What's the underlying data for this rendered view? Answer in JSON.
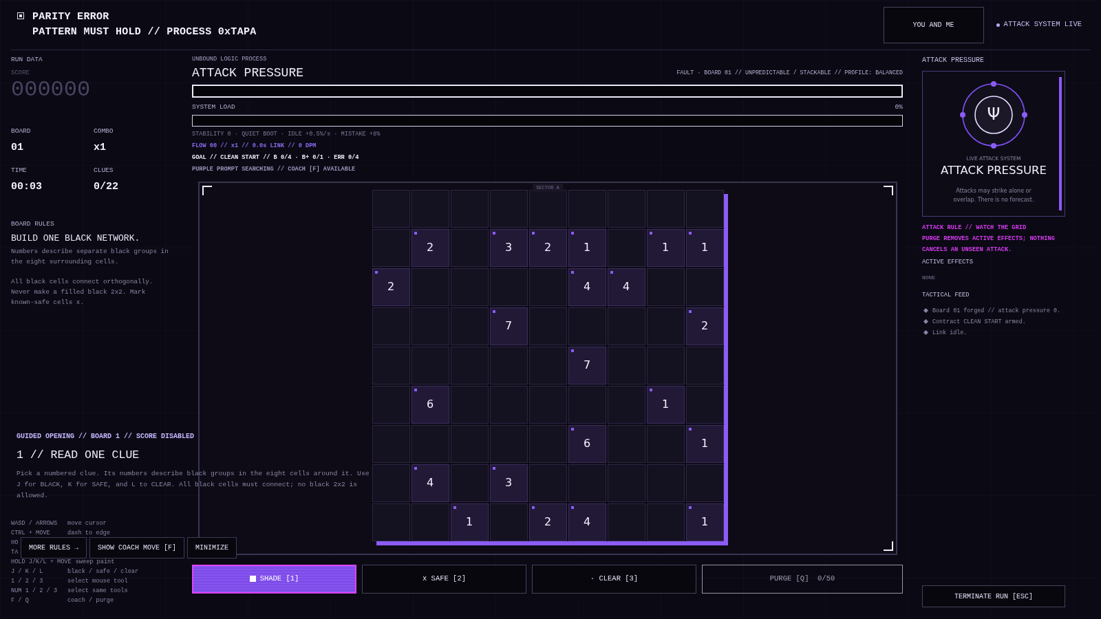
{
  "header": {
    "lines": [
      "PARITY ERROR",
      "PATTERN MUST HOLD // PROCESS 0xTAPA"
    ],
    "partner_button": "YOU AND ME",
    "status": "ATTACK SYSTEM LIVE"
  },
  "run_data": {
    "title": "RUN DATA",
    "score_label": "SCORE",
    "score": "000000",
    "stats": [
      {
        "label": "BOARD",
        "value": "01"
      },
      {
        "label": "COMBO",
        "value": "x1"
      },
      {
        "label": "TIME",
        "value": "00:03"
      },
      {
        "label": "CLUES",
        "value": "0/22"
      }
    ]
  },
  "board_rules": {
    "title": "BOARD RULES",
    "heading": "BUILD ONE BLACK NETWORK.",
    "paragraphs": [
      "Numbers describe separate black groups in the eight surrounding cells.",
      "All black cells connect orthogonally. Never make a filled black 2x2. Mark known-safe cells x."
    ]
  },
  "shortcuts": [
    {
      "keys": "WASD / ARROWS",
      "action": "move cursor"
    },
    {
      "keys": "CTRL + MOVE",
      "action": "dash to edge"
    },
    {
      "keys": "HO"
    },
    {
      "keys": "TA"
    },
    {
      "keys": "HOLD J/K/L + MOVE",
      "action": "sweep paint"
    },
    {
      "keys": "J / K / L",
      "action": "black / safe / clear"
    },
    {
      "keys": "1 / 2 / 3",
      "action": "select mouse tool"
    },
    {
      "keys": "NUM 1 / 2 / 3",
      "action": "select same tools"
    },
    {
      "keys": "F / Q",
      "action": "coach / purge"
    }
  ],
  "guide": {
    "kicker": "GUIDED OPENING // BOARD 1 // SCORE DISABLED",
    "heading": "1 // READ ONE CLUE",
    "text": "Pick a numbered clue. Its numbers describe black groups in the eight cells around it. Use J for BLACK, K for SAFE, and L to CLEAR. All black cells must connect; no black 2x2 is allowed.",
    "buttons": [
      "MORE RULES →",
      "SHOW COACH MOVE [F]",
      "MINIMIZE"
    ]
  },
  "process": {
    "kicker": "UNBOUND LOGIC PROCESS",
    "title": "ATTACK PRESSURE",
    "fault": "FAULT · BOARD 01 // UNPREDICTABLE / STACKABLE // PROFILE: BALANCED",
    "pressure": {
      "level": 0
    },
    "load": {
      "label": "SYSTEM LOAD",
      "reading": "0%",
      "level": 0
    },
    "lines": [
      {
        "kind": "plain",
        "text": "STABILITY 0 · QUIET BOOT · IDLE +0.5%/s · MISTAKE +8%"
      },
      {
        "kind": "flow",
        "text": "FLOW 00 // x1 // 0.0s LINK // 0 DPM"
      },
      {
        "kind": "goal",
        "text": "GOAL // CLEAN START // B 0/4 · B+ 0/1 · ERR 0/4"
      },
      {
        "kind": "prompt",
        "text": "PURPLE PROMPT SEARCHING // COACH [F] AVAILABLE"
      }
    ]
  },
  "board": {
    "sector": "SECTOR A",
    "rows": [
      [
        null,
        null,
        null,
        null,
        null,
        null,
        null,
        null,
        null
      ],
      [
        null,
        "2",
        null,
        "3",
        "2",
        "1",
        null,
        "1",
        "1"
      ],
      [
        "2",
        null,
        null,
        null,
        null,
        "4",
        "4",
        null,
        null
      ],
      [
        null,
        null,
        null,
        "7",
        null,
        null,
        null,
        null,
        "2"
      ],
      [
        null,
        null,
        null,
        null,
        null,
        "7",
        null,
        null,
        null
      ],
      [
        null,
        "6",
        null,
        null,
        null,
        null,
        null,
        "1",
        null
      ],
      [
        null,
        null,
        null,
        null,
        null,
        "6",
        null,
        null,
        "1"
      ],
      [
        null,
        "4",
        null,
        "3",
        null,
        null,
        null,
        null,
        null
      ],
      [
        null,
        null,
        "1",
        null,
        "2",
        "4",
        null,
        null,
        "1"
      ]
    ]
  },
  "tools": [
    {
      "kind": "shade",
      "label": "SHADE [1]",
      "selected": true,
      "disabled": false
    },
    {
      "kind": "safe",
      "label": "x SAFE [2]",
      "selected": false,
      "disabled": false
    },
    {
      "kind": "clear",
      "label": "· CLEAR [3]",
      "selected": false,
      "disabled": false
    },
    {
      "kind": "purge",
      "label": "PURGE [Q]  0/50",
      "selected": false,
      "disabled": true
    }
  ],
  "attack_panel": {
    "title": "ATTACK PRESSURE",
    "card": {
      "symbol": "Ψ",
      "kicker": "LIVE ATTACK SYSTEM",
      "title": "ATTACK PRESSURE",
      "text": "Attacks may strike alone or overlap. There is no forecast."
    },
    "rule_lines": [
      "ATTACK RULE // WATCH THE GRID",
      "PURGE REMOVES ACTIVE EFFECTS; NOTHING CANCELS AN UNSEEN ATTACK."
    ],
    "effects_title": "ACTIVE EFFECTS",
    "effects": "NONE",
    "feed_title": "TACTICAL FEED",
    "feed": [
      "Board 01 forged // attack pressure 0.",
      "Contract CLEAN START armed.",
      "Link idle."
    ]
  },
  "terminate_button": "TERMINATE RUN [ESC]"
}
